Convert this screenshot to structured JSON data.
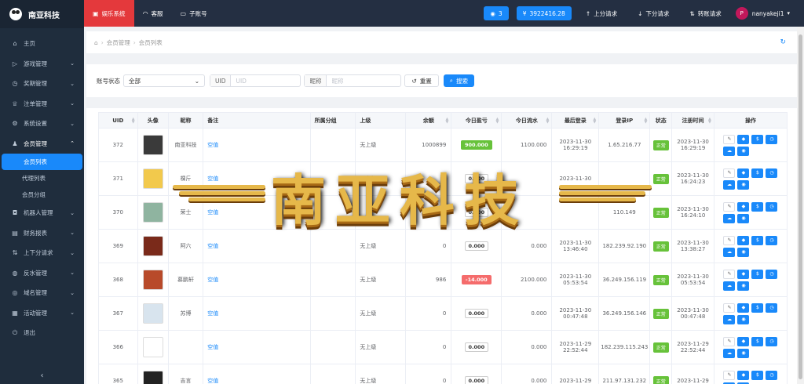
{
  "app": {
    "logo_text": "南亚科技"
  },
  "sidebar": {
    "items": [
      {
        "label": "主页",
        "icon": "home-icon",
        "arrow": ""
      },
      {
        "label": "游戏管理",
        "icon": "play-icon",
        "arrow": "⌄"
      },
      {
        "label": "奖期管理",
        "icon": "clock-icon",
        "arrow": "⌄"
      },
      {
        "label": "注单管理",
        "icon": "trophy-icon",
        "arrow": "⌄"
      },
      {
        "label": "系统设置",
        "icon": "gear-icon",
        "arrow": "⌄"
      },
      {
        "label": "会员管理",
        "icon": "user-icon",
        "arrow": "⌃"
      }
    ],
    "subitems": [
      "会员列表",
      "代理列表",
      "会员分组"
    ],
    "items2": [
      {
        "label": "机器人管理",
        "icon": "robot-icon",
        "arrow": "⌄"
      },
      {
        "label": "财务报表",
        "icon": "report-icon",
        "arrow": "⌄"
      },
      {
        "label": "上下分请求",
        "icon": "transfer-icon",
        "arrow": "⌄"
      },
      {
        "label": "反水管理",
        "icon": "rebate-icon",
        "arrow": "⌄"
      },
      {
        "label": "域名管理",
        "icon": "globe-icon",
        "arrow": "⌄"
      },
      {
        "label": "活动管理",
        "icon": "calendar-icon",
        "arrow": "⌄"
      },
      {
        "label": "退出",
        "icon": "logout-icon",
        "arrow": ""
      }
    ],
    "collapse_glyph": "‹"
  },
  "topbar": {
    "nav": [
      "娱乐系统",
      "客服",
      "子账号"
    ],
    "online_count": "3",
    "balance": "3922416.28",
    "up_request": "上分请求",
    "down_request": "下分请求",
    "transfer_request": "转账请求",
    "avatar_letter": "P",
    "username": "nanyakeji1"
  },
  "breadcrumb": [
    "会员管理",
    "会员列表"
  ],
  "filter": {
    "status_label": "账号状态",
    "status_value": "全部",
    "uid_label": "UID",
    "uid_placeholder": "UID",
    "nick_label": "昵称",
    "nick_placeholder": "昵称",
    "reset": "重置",
    "search": "搜索"
  },
  "table": {
    "columns": [
      "UID",
      "头像",
      "昵称",
      "备注",
      "所属分组",
      "上级",
      "余额",
      "今日盈亏",
      "今日流水",
      "最后登录",
      "登录IP",
      "状态",
      "注册时间",
      "操作"
    ],
    "rows": [
      {
        "uid": "372",
        "nick": "南亚科技",
        "note": "空值",
        "group": "",
        "parent": "无上级",
        "balance": "1000899",
        "pnl": "900.000",
        "pnl_type": "pos",
        "flow": "1100.000",
        "last_date": "2023-11-30",
        "last_time": "16:29:19",
        "ip": "1.65.216.77",
        "status": "正常",
        "reg_date": "2023-11-30",
        "reg_time": "16:29:19",
        "avatar_color": "#3a3a3a"
      },
      {
        "uid": "371",
        "nick": "棵斤",
        "note": "空值",
        "group": "",
        "parent": "无上级",
        "balance": "",
        "pnl": "0.000",
        "pnl_type": "zero",
        "flow": "",
        "last_date": "2023-11-30",
        "last_time": "",
        "ip": "",
        "status": "正常",
        "reg_date": "2023-11-30",
        "reg_time": "16:24:23",
        "avatar_color": "#f2c94c"
      },
      {
        "uid": "370",
        "nick": "荣士",
        "note": "空值",
        "group": "",
        "parent": "",
        "balance": "",
        "pnl": "0.000",
        "pnl_type": "zero",
        "flow": "",
        "last_date": "",
        "last_time": "",
        "ip": "110.149",
        "status": "正常",
        "reg_date": "2023-11-30",
        "reg_time": "16:24:10",
        "avatar_color": "#8fb4a0"
      },
      {
        "uid": "369",
        "nick": "阿六",
        "note": "空值",
        "group": "",
        "parent": "无上级",
        "balance": "0",
        "pnl": "0.000",
        "pnl_type": "zero",
        "flow": "0.000",
        "last_date": "2023-11-30",
        "last_time": "13:46:40",
        "ip": "182.239.92.190",
        "status": "正常",
        "reg_date": "2023-11-30",
        "reg_time": "13:38:27",
        "avatar_color": "#7a2a1a"
      },
      {
        "uid": "368",
        "nick": "慕鹏轩",
        "note": "空值",
        "group": "",
        "parent": "无上级",
        "balance": "986",
        "pnl": "-14.000",
        "pnl_type": "neg",
        "flow": "2100.000",
        "last_date": "2023-11-30",
        "last_time": "05:53:54",
        "ip": "36.249.156.119",
        "status": "正常",
        "reg_date": "2023-11-30",
        "reg_time": "05:53:54",
        "avatar_color": "#b84a2a"
      },
      {
        "uid": "367",
        "nick": "苏博",
        "note": "空值",
        "group": "",
        "parent": "无上级",
        "balance": "0",
        "pnl": "0.000",
        "pnl_type": "zero",
        "flow": "0.000",
        "last_date": "2023-11-30",
        "last_time": "00:47:48",
        "ip": "36.249.156.146",
        "status": "正常",
        "reg_date": "2023-11-30",
        "reg_time": "00:47:48",
        "avatar_color": "#d8e4ee"
      },
      {
        "uid": "366",
        "nick": "",
        "note": "空值",
        "group": "",
        "parent": "无上级",
        "balance": "0",
        "pnl": "0.000",
        "pnl_type": "zero",
        "flow": "0.000",
        "last_date": "2023-11-29",
        "last_time": "22:52:44",
        "ip": "182.239.115.243",
        "status": "正常",
        "reg_date": "2023-11-29",
        "reg_time": "22:52:44",
        "avatar_color": "#ffffff"
      },
      {
        "uid": "365",
        "nick": "吉言",
        "note": "空值",
        "group": "",
        "parent": "无上级",
        "balance": "0",
        "pnl": "0.000",
        "pnl_type": "zero",
        "flow": "0.000",
        "last_date": "2023-11-29",
        "last_time": "",
        "ip": "211.97.131.232",
        "status": "正常",
        "reg_date": "2023-11-29",
        "reg_time": "",
        "avatar_color": "#222222"
      }
    ]
  },
  "overlay": {
    "text": "南亚科技"
  }
}
